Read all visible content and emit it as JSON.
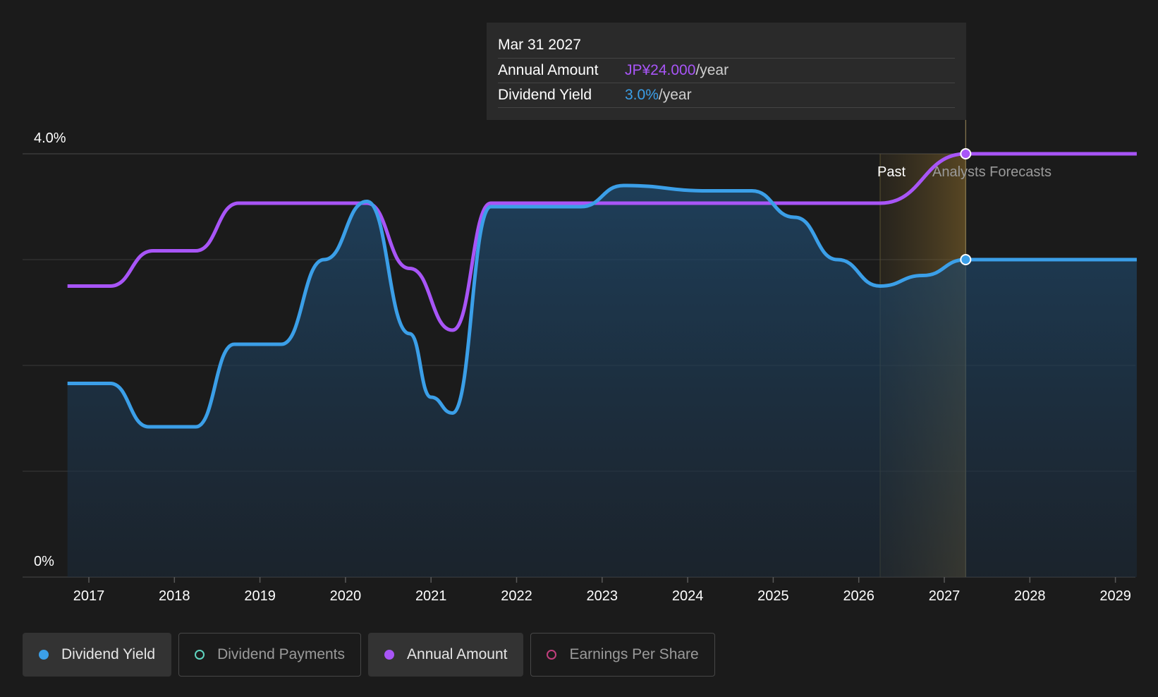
{
  "tooltip": {
    "date": "Mar 31 2027",
    "annual_label": "Annual Amount",
    "annual_value": "JP¥24.000",
    "annual_unit": "/year",
    "yield_label": "Dividend Yield",
    "yield_value": "3.0%",
    "yield_unit": "/year"
  },
  "legend": [
    {
      "label": "Dividend Yield",
      "active": true
    },
    {
      "label": "Dividend Payments",
      "active": false
    },
    {
      "label": "Annual Amount",
      "active": true
    },
    {
      "label": "Earnings Per Share",
      "active": false
    }
  ],
  "colors": {
    "dividend_yield": "#3b9fe8",
    "annual_amount": "#a855f7",
    "dividend_payments": "#5fd4c0",
    "earnings_per_share": "#c23f7d",
    "background": "#1b1b1b"
  },
  "chart_data": {
    "type": "line",
    "x_ticks": [
      "2017",
      "2018",
      "2019",
      "2020",
      "2021",
      "2022",
      "2023",
      "2024",
      "2025",
      "2026",
      "2027",
      "2028",
      "2029"
    ],
    "y_tick_labels": [
      "4.0%",
      "0%"
    ],
    "ylim": [
      0,
      4.0
    ],
    "grid": true,
    "region_labels": {
      "past": "Past",
      "forecast": "Analysts Forecasts"
    },
    "past_end": 2026.25,
    "forecast_end": 2027.25,
    "series": [
      {
        "name": "Dividend Yield",
        "unit": "%",
        "points": [
          [
            2016.75,
            1.83
          ],
          [
            2017.25,
            1.83
          ],
          [
            2017.7,
            1.42
          ],
          [
            2018.25,
            1.42
          ],
          [
            2018.7,
            2.2
          ],
          [
            2019.25,
            2.2
          ],
          [
            2019.75,
            3.0
          ],
          [
            2020.25,
            3.55
          ],
          [
            2020.75,
            2.3
          ],
          [
            2021.0,
            1.7
          ],
          [
            2021.25,
            1.55
          ],
          [
            2021.7,
            3.5
          ],
          [
            2022.75,
            3.5
          ],
          [
            2023.25,
            3.7
          ],
          [
            2024.25,
            3.65
          ],
          [
            2024.75,
            3.65
          ],
          [
            2025.25,
            3.4
          ],
          [
            2025.75,
            3.0
          ],
          [
            2026.25,
            2.75
          ],
          [
            2026.75,
            2.85
          ],
          [
            2027.25,
            3.0
          ],
          [
            2029.25,
            3.0
          ]
        ]
      },
      {
        "name": "Annual Amount",
        "unit": "JP¥",
        "points": [
          [
            2016.75,
            16.5
          ],
          [
            2017.25,
            16.5
          ],
          [
            2017.75,
            18.5
          ],
          [
            2018.25,
            18.5
          ],
          [
            2018.75,
            21.2
          ],
          [
            2020.25,
            21.2
          ],
          [
            2020.75,
            17.5
          ],
          [
            2021.25,
            14.0
          ],
          [
            2021.7,
            21.2
          ],
          [
            2026.25,
            21.2
          ],
          [
            2027.25,
            24.0
          ],
          [
            2029.25,
            24.0
          ]
        ]
      }
    ],
    "annual_amount_axis": [
      0,
      24.0
    ]
  }
}
